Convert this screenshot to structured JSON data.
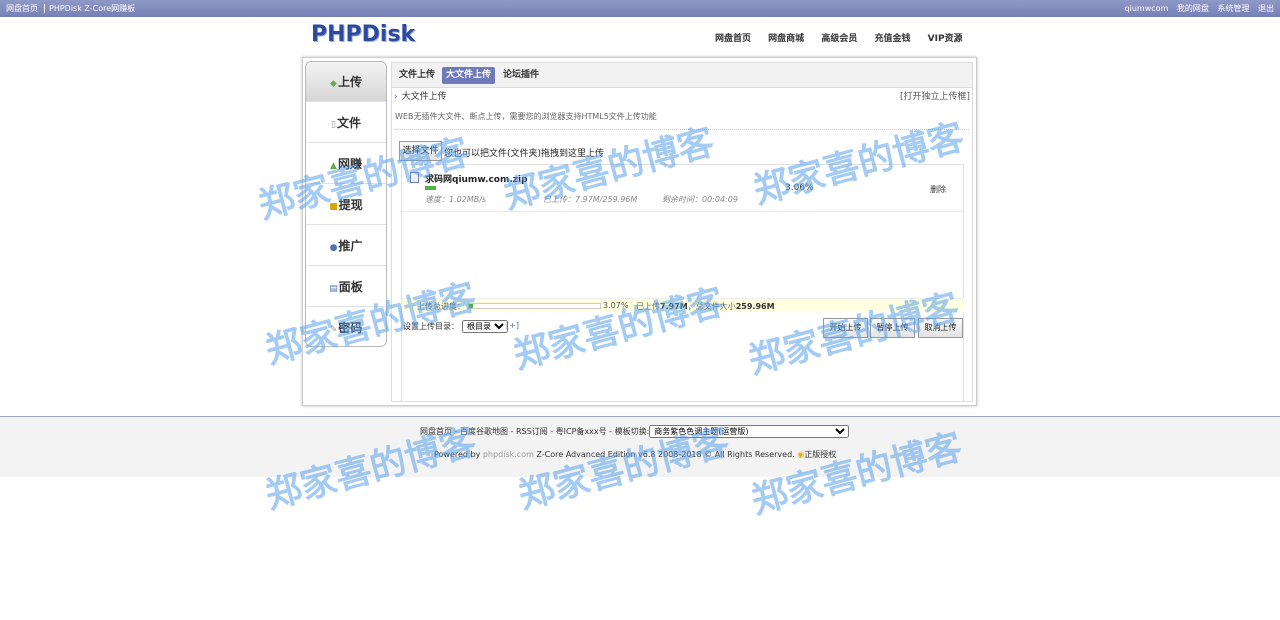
{
  "topbar": {
    "left": [
      "网盘首页",
      "PHPDisk Z-Core网赚板"
    ],
    "right": [
      "qiumwcom",
      "我的网盘",
      "系统管理",
      "退出"
    ]
  },
  "header": {
    "logo": "PHPDisk",
    "nav": [
      "网盘首页",
      "网盘商城",
      "高级会员",
      "充值金钱",
      "VIP资源"
    ]
  },
  "sidebar": {
    "items": [
      {
        "label": "上传",
        "icon": "upload-icon",
        "active": true
      },
      {
        "label": "文件",
        "icon": "file-icon"
      },
      {
        "label": "网赚",
        "icon": "earn-icon"
      },
      {
        "label": "提现",
        "icon": "withdraw-icon"
      },
      {
        "label": "推广",
        "icon": "promote-icon"
      },
      {
        "label": "面板",
        "icon": "panel-icon"
      },
      {
        "label": "密码",
        "icon": "password-icon"
      }
    ]
  },
  "tabs": [
    {
      "label": "文件上传"
    },
    {
      "label": "大文件上传",
      "active": true
    },
    {
      "label": "论坛插件"
    }
  ],
  "upload": {
    "title": "大文件上传",
    "open_link": "[打开独立上传框]",
    "desc": "WEB无插件大文件、断点上传，需要您的浏览器支持HTML5文件上传功能",
    "pick_button": "选择文件",
    "drop_tip": "您也可以把文件(文件夹)拖拽到这里上传",
    "file": {
      "name": "求码网qiumw.com.zip",
      "progress": 3.06,
      "percent": "3.06%",
      "delete": "删除",
      "speed": "速度：1.02MB/s",
      "uploaded": "已上传：7.97M/259.96M",
      "remaining": "剩余时间：00:04:09"
    },
    "total": {
      "label": "上传总进度：",
      "progress": 3.07,
      "percent": "3.07%",
      "uploaded_prefix": "已上传",
      "uploaded": "7.97M",
      "size_prefix": "，总文件大小",
      "size": "259.96M"
    },
    "dir_label": "设置上传目录：",
    "dir_value": "根目录",
    "dir_add": "[+]",
    "buttons": {
      "start": "开始上传",
      "pause": "暂停上传",
      "cancel": "取消上传"
    }
  },
  "footer": {
    "links": "网盘首页 - 百度谷歌地图 - RSS订阅 - 粤ICP备xxx号 - 模板切换:",
    "theme": "商务紫色色调主题(运营版)",
    "powered_prefix": "Powered by ",
    "powered_link": "phpdisk.com",
    "powered_suffix": " Z-Core Advanced Edition v6.8 2008-2018 © All Rights Reserved.",
    "auth": "正版授权"
  },
  "watermark": "郑家喜的博客",
  "colors": {
    "accent": "#6f7ab8",
    "progress": "#4fb343",
    "logo": "#2d4a9c"
  }
}
